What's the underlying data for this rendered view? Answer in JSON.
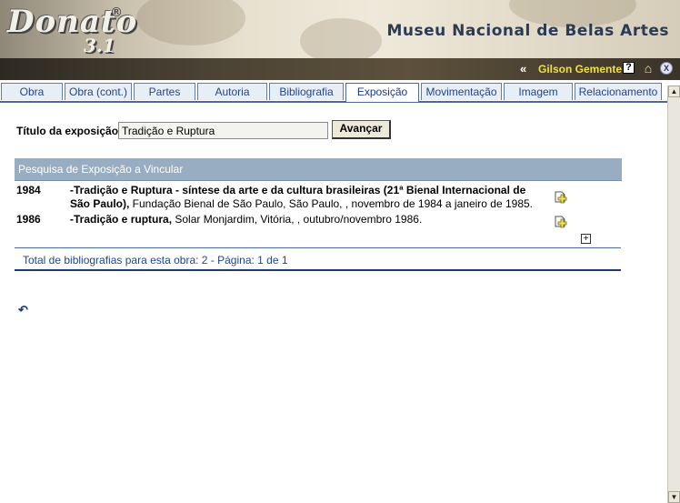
{
  "header": {
    "logo_text": "Donato",
    "logo_registered": "®",
    "logo_version": "3.1",
    "museum_name": "Museu Nacional de Belas Artes"
  },
  "userbar": {
    "chevron": "«",
    "user_name": "Gilson Gemente",
    "help_icon": "?",
    "home_icon": "⌂",
    "exit_icon": "X"
  },
  "tabs": [
    {
      "label": "Obra",
      "active": false
    },
    {
      "label": "Obra (cont.)",
      "active": false
    },
    {
      "label": "Partes",
      "active": false
    },
    {
      "label": "Autoria",
      "active": false
    },
    {
      "label": "Bibliografia",
      "active": false
    },
    {
      "label": "Exposição",
      "active": true
    },
    {
      "label": "Movimentação",
      "active": false
    },
    {
      "label": "Imagem",
      "active": false
    },
    {
      "label": "Relacionamento",
      "active": false
    }
  ],
  "form": {
    "title_label": "Título da exposição:",
    "title_value": "Tradição e Ruptura",
    "submit_label": "Avançar"
  },
  "results": {
    "heading": "Pesquisa de Exposição a Vincular",
    "items": [
      {
        "year": "1984",
        "title": "-Tradição e Ruptura - síntese da arte e da cultura brasileiras (21ª Bienal Internacional de São Paulo),",
        "details": " Fundação Bienal de São Paulo, São Paulo, , novembro de 1984 a janeiro de 1985."
      },
      {
        "year": "1986",
        "title": "-Tradição e ruptura,",
        "details": " Solar Monjardim, Vitória, , outubro/novembro 1986."
      }
    ],
    "expand_label": "+",
    "footer": "Total de bibliografias para esta obra: 2 - Página: 1 de 1"
  },
  "back_icon": "↶",
  "colors": {
    "tab_text": "#22458a",
    "section_header": "#98adc1",
    "user_name": "#f0e040"
  }
}
